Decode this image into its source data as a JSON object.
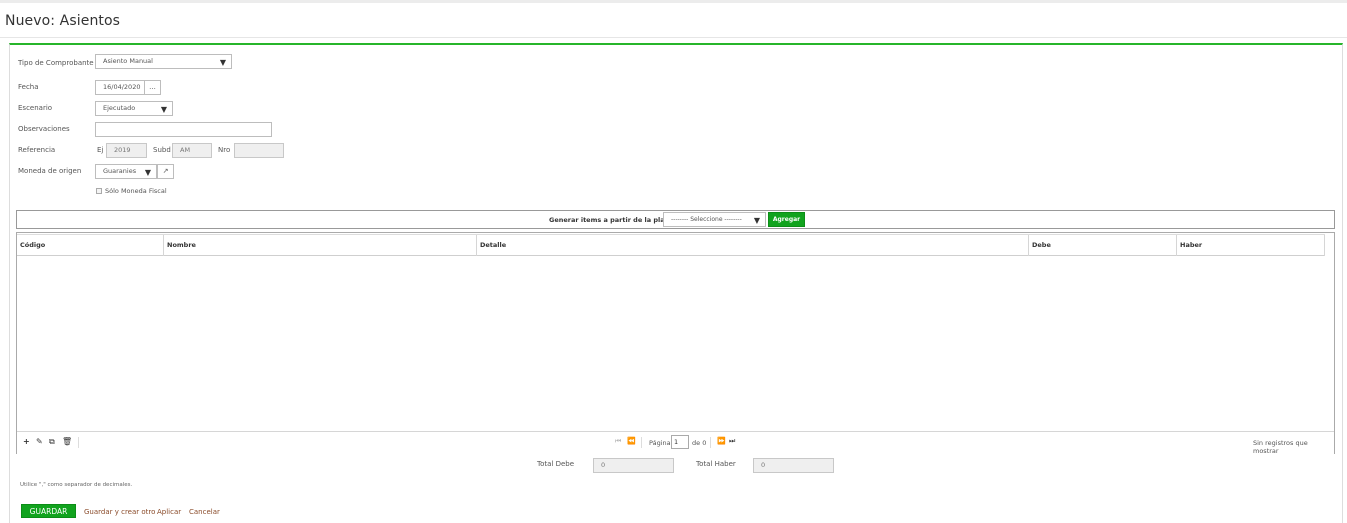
{
  "page": {
    "title": "Nuevo: Asientos"
  },
  "form": {
    "tipo_label": "Tipo de Comprobante",
    "tipo_value": "Asiento Manual",
    "fecha_label": "Fecha",
    "fecha_value": "16/04/2020",
    "fecha_picker": "...",
    "escenario_label": "Escenario",
    "escenario_value": "Ejecutado",
    "observaciones_label": "Observaciones",
    "observaciones_value": "",
    "referencia_label": "Referencia",
    "ej_label": "Ej",
    "ej_value": "2019",
    "subd_label": "Subd",
    "subd_value": "AM",
    "nro_label": "Nro",
    "nro_value": "",
    "moneda_label": "Moneda de origen",
    "moneda_value": "Guaranies",
    "solo_fiscal_label": "Sólo Moneda Fiscal",
    "solo_fiscal_checked": false
  },
  "template_bar": {
    "label": "Generar items a partir de la plantilla",
    "select_value": "-------- Seleccione --------",
    "add_button": "Agregar"
  },
  "grid": {
    "columns": [
      "Código",
      "Nombre",
      "Detalle",
      "Debe",
      "Haber"
    ],
    "rows": [],
    "pager": {
      "page_label": "Página",
      "page_value": "1",
      "of_label": "de 0"
    },
    "empty_text": "Sin registros que mostrar",
    "icons": [
      "add-icon",
      "edit-icon",
      "copy-icon",
      "delete-icon"
    ]
  },
  "totals": {
    "debe_label": "Total Debe",
    "debe_value": "0",
    "haber_label": "Total Haber",
    "haber_value": "0"
  },
  "note": "Utilice \",\" como separador de decimales.",
  "actions": {
    "save": "GUARDAR",
    "save_and_new": "Guardar y crear otro",
    "apply": "Aplicar",
    "cancel": "Cancelar"
  },
  "colors": {
    "accent": "#27b52a",
    "button_green": "#11a31e",
    "link": "#8a4b2a"
  }
}
